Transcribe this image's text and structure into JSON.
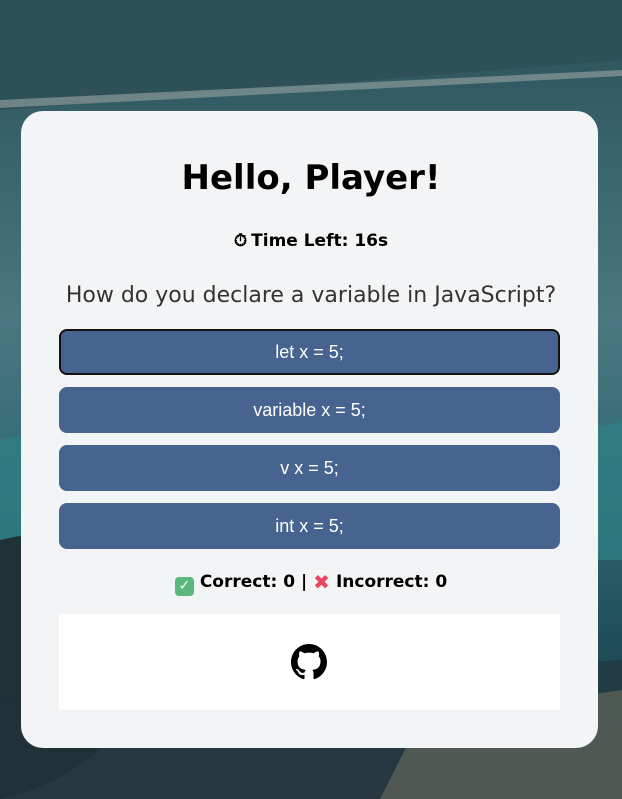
{
  "greeting": "Hello, Player!",
  "timer": {
    "icon": "stopwatch-icon",
    "label": "Time Left: 16s"
  },
  "question": "How do you declare a variable in JavaScript?",
  "options": [
    {
      "label": "let x = 5;",
      "selected": true
    },
    {
      "label": "variable x = 5;",
      "selected": false
    },
    {
      "label": "v x = 5;",
      "selected": false
    },
    {
      "label": "int x = 5;",
      "selected": false
    }
  ],
  "score": {
    "correct_icon": "check-mark-icon",
    "correct_label": "Correct: 0",
    "separator": "|",
    "incorrect_icon": "cross-mark-icon",
    "incorrect_label": "Incorrect: 0"
  },
  "footer": {
    "link_icon": "github-icon"
  },
  "colors": {
    "option_bg": "#476390",
    "card_bg": "#f2f4f5",
    "correct": "#59b97c",
    "incorrect": "#e8475c"
  }
}
